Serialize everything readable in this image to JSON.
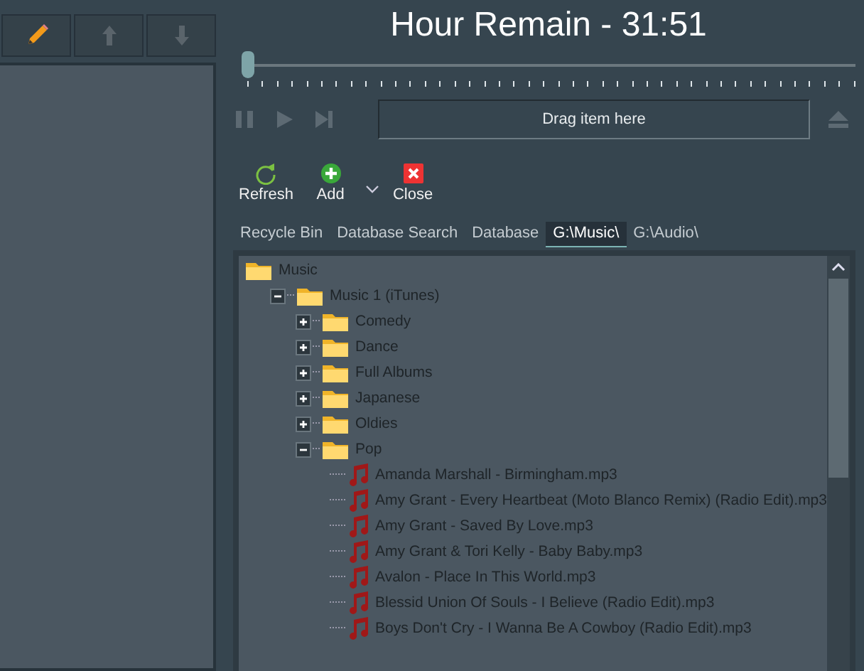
{
  "side_toolbar": [
    {
      "kind": "pencil",
      "disabled": false
    },
    {
      "kind": "up",
      "disabled": true
    },
    {
      "kind": "down",
      "disabled": true
    }
  ],
  "title": "Hour Remain - 31:51",
  "seek": {
    "level": 0.0
  },
  "transport": [
    {
      "kind": "pause",
      "disabled": true
    },
    {
      "kind": "play",
      "disabled": true
    },
    {
      "kind": "next",
      "disabled": true
    }
  ],
  "drop_zone": "Drag item here",
  "toolbar": [
    {
      "kind": "refresh",
      "label": "Refresh"
    },
    {
      "kind": "add",
      "label": "Add"
    },
    {
      "kind": "dropdown"
    },
    {
      "kind": "close",
      "label": "Close"
    }
  ],
  "tabs": [
    {
      "label": "Recycle Bin",
      "selected": false
    },
    {
      "label": "Database Search",
      "selected": false
    },
    {
      "label": "Database",
      "selected": false
    },
    {
      "label": "G:\\Music\\",
      "selected": true
    },
    {
      "label": "G:\\Audio\\",
      "selected": false
    }
  ],
  "tree": [
    {
      "kind": "folder",
      "label": "Music",
      "children": [
        {
          "kind": "folder",
          "label": "Music 1 (iTunes)",
          "expanded": true,
          "children": [
            {
              "kind": "folder",
              "label": "Comedy",
              "expanded": false
            },
            {
              "kind": "folder",
              "label": "Dance",
              "expanded": false
            },
            {
              "kind": "folder",
              "label": "Full Albums",
              "expanded": false
            },
            {
              "kind": "folder",
              "label": "Japanese",
              "expanded": false
            },
            {
              "kind": "folder",
              "label": "Oldies",
              "expanded": false
            },
            {
              "kind": "folder",
              "label": "Pop",
              "expanded": true,
              "children": [
                {
                  "kind": "file",
                  "label": "Amanda Marshall - Birmingham.mp3"
                },
                {
                  "kind": "file",
                  "label": "Amy Grant - Every Heartbeat (Moto Blanco Remix) (Radio Edit).mp3"
                },
                {
                  "kind": "file",
                  "label": "Amy Grant - Saved By Love.mp3"
                },
                {
                  "kind": "file",
                  "label": "Amy Grant & Tori Kelly - Baby Baby.mp3"
                },
                {
                  "kind": "file",
                  "label": "Avalon - Place In This World.mp3"
                },
                {
                  "kind": "file",
                  "label": "Blessid Union Of Souls - I Believe (Radio Edit).mp3"
                },
                {
                  "kind": "file",
                  "label": "Boys Don't Cry - I Wanna Be A Cowboy (Radio Edit).mp3"
                }
              ]
            }
          ]
        }
      ]
    }
  ]
}
